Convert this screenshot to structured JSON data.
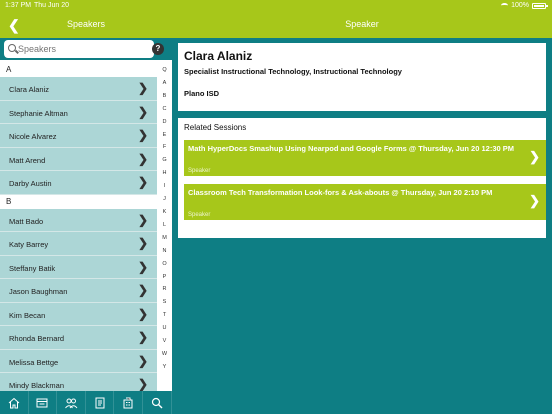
{
  "status": {
    "time": "1:37 PM",
    "date": "Thu Jun 20",
    "battery": "100%"
  },
  "nav": {
    "left_title": "Speakers",
    "right_title": "Speaker"
  },
  "search": {
    "placeholder": "Speakers"
  },
  "sections": [
    {
      "letter": "A",
      "speakers": [
        "Clara Alaniz",
        "Stephanie Altman",
        "Nicole Alvarez",
        "Matt Arend",
        "Darby Austin"
      ]
    },
    {
      "letter": "B",
      "speakers": [
        "Matt Bado",
        "Katy Barrey",
        "Steffany Batik",
        "Jason Baughman",
        "Kim Becan",
        "Rhonda Bernard",
        "Melissa Bettge",
        "Mindy Blackman"
      ]
    }
  ],
  "alphabet": [
    "Q",
    "A",
    "B",
    "C",
    "D",
    "E",
    "F",
    "G",
    "H",
    "I",
    "J",
    "K",
    "L",
    "M",
    "N",
    "O",
    "P",
    "R",
    "S",
    "T",
    "U",
    "V",
    "W",
    "Y"
  ],
  "speaker": {
    "name": "Clara Alaniz",
    "title": "Specialist Instructional Technology, Instructional Technology",
    "org": "Plano ISD"
  },
  "related": {
    "title": "Related Sessions",
    "sessions": [
      {
        "title": "Math HyperDocs Smashup Using Nearpod and Google Forms @ Thursday, Jun 20 12:30 PM",
        "role": "Speaker"
      },
      {
        "title": "Classroom Tech Transformation Look-fors & Ask-abouts @ Thursday, Jun 20 2:10 PM",
        "role": "Speaker"
      }
    ]
  },
  "tabs": [
    "home-icon",
    "agenda-icon",
    "people-icon",
    "document-icon",
    "building-icon",
    "search-icon"
  ]
}
